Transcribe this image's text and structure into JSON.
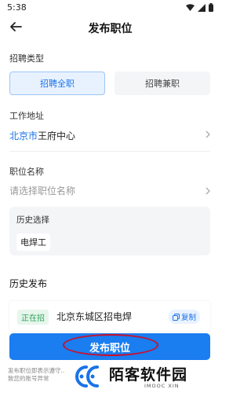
{
  "status_bar": {
    "time": "5:38"
  },
  "header": {
    "title": "发布职位"
  },
  "recruit_type": {
    "label": "招聘类型",
    "options": [
      "招聘全职",
      "招聘兼职"
    ],
    "selected": "招聘全职"
  },
  "work_location": {
    "label": "工作地址",
    "city": "北京市",
    "place": "王府中心"
  },
  "job_name": {
    "label": "职位名称",
    "placeholder": "请选择职位名称",
    "history_label": "历史选择",
    "history_items": [
      "电焊工"
    ]
  },
  "history_posts": {
    "label": "历史发布",
    "items": [
      {
        "status": "正在招",
        "title": "北京东城区招电焊",
        "action": "复制"
      }
    ]
  },
  "submit": {
    "label": "发布职位"
  },
  "disclaimer": "发布职位即表示遵守... 致您的账号异常",
  "watermark": {
    "text": "陌客软件园",
    "sub": "IMOOC XIN"
  },
  "colors": {
    "accent": "#1a7df0",
    "status_green": "#2ea35a",
    "annotation_red": "#c8102e"
  }
}
